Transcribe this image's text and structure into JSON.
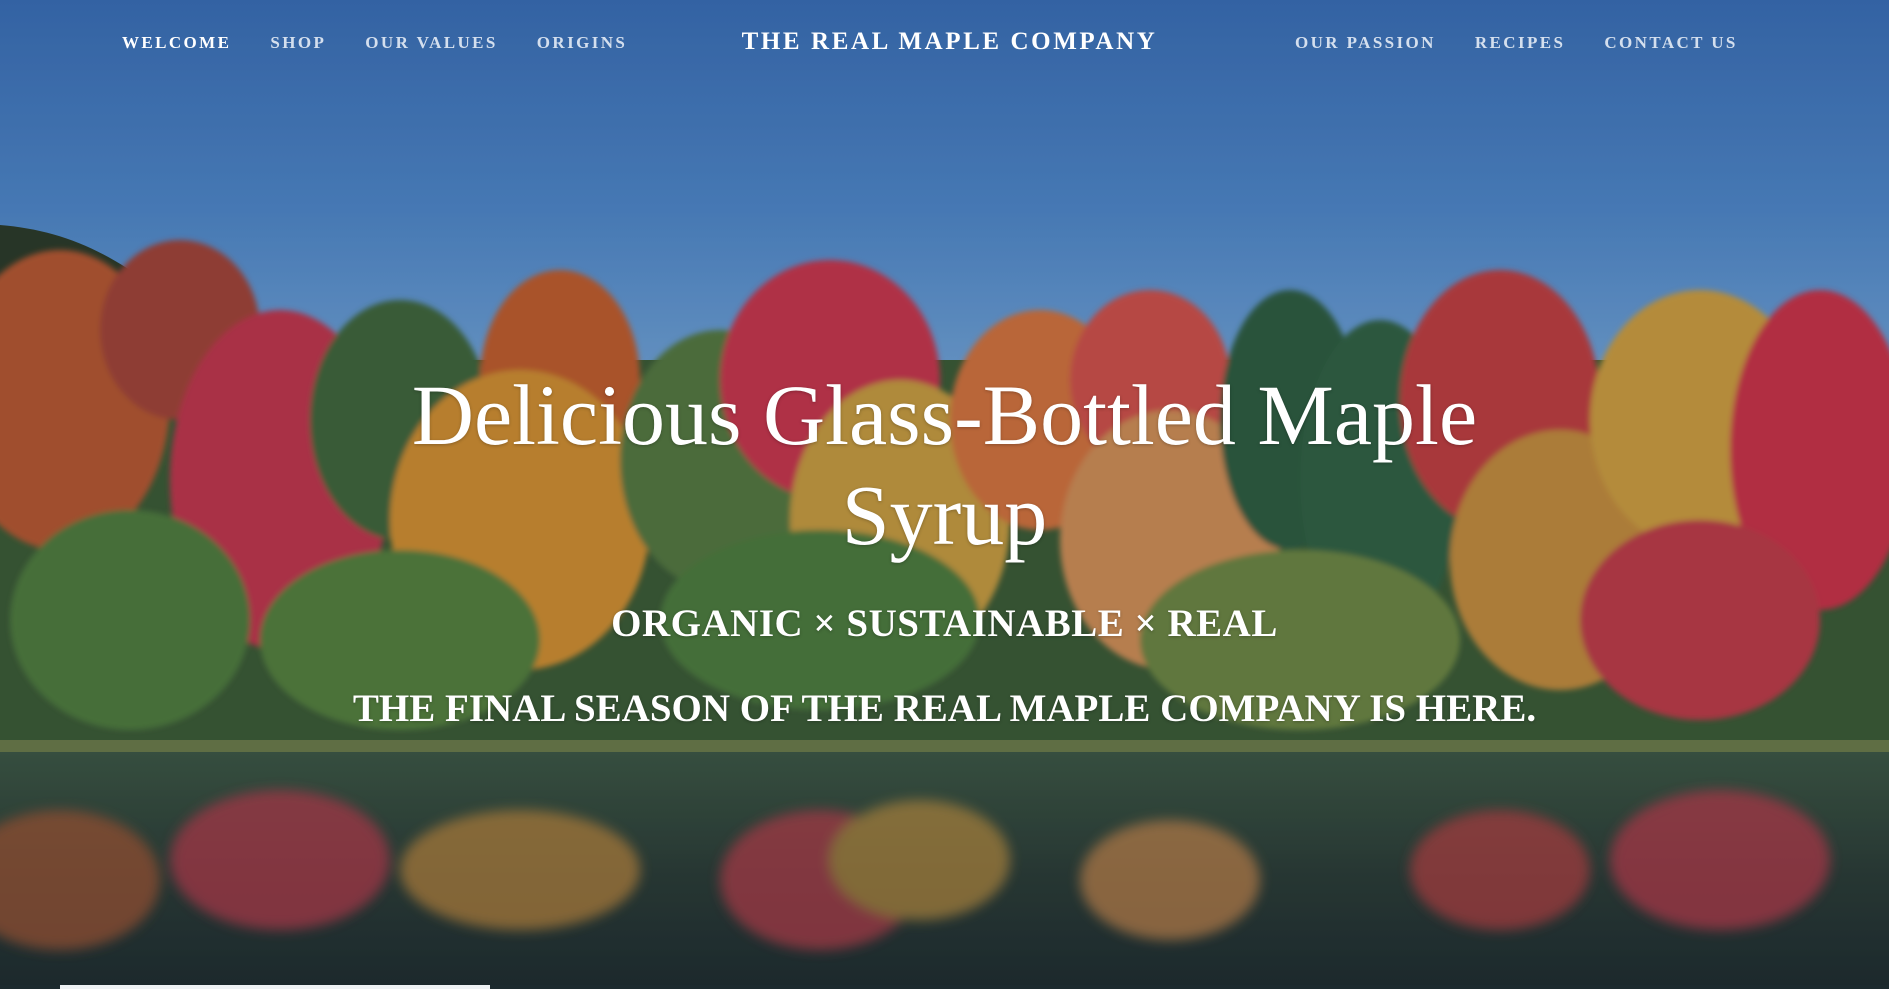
{
  "nav": {
    "left": [
      {
        "label": "WELCOME",
        "active": true
      },
      {
        "label": "SHOP"
      },
      {
        "label": "OUR VALUES"
      },
      {
        "label": "ORIGINS"
      }
    ],
    "brand": "THE REAL MAPLE COMPANY",
    "right": [
      {
        "label": "OUR PASSION"
      },
      {
        "label": "RECIPES"
      },
      {
        "label": "CONTACT US"
      }
    ]
  },
  "hero": {
    "headline": "Delicious Glass-Bottled Maple Syrup",
    "tagline": "ORGANIC × SUSTAINABLE × REAL",
    "announcement": "THE FINAL SEASON OF THE REAL MAPLE COMPANY IS HERE."
  },
  "colors": {
    "sky": "#3a6fb0",
    "nav_text": "#ebf0f8",
    "text": "#ffffff"
  }
}
